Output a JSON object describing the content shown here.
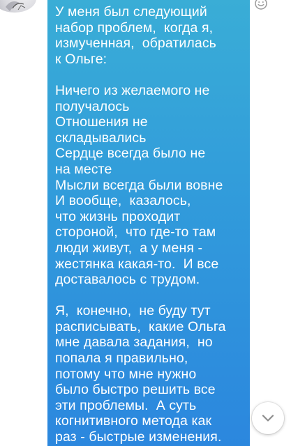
{
  "message": {
    "lines": [
      "У меня был следующий",
      "набор проблем,  когда я,",
      "измученная,  обратилась",
      "к Ольге:",
      "",
      "Ничего из желаемого не",
      "получалось",
      "Отношения не",
      "складывались",
      "Сердце всегда было не",
      "на месте",
      "Мысли всегда были вовне",
      "И вообще,  казалось,",
      "что жизнь проходит",
      "стороной,  что где-то там",
      "люди живут,  а у меня -",
      "жестянка какая-то.  И все",
      "доставалось с трудом.",
      "",
      "Я,  конечно,  не буду тут",
      "расписывать,  какие Ольга",
      "мне давала задания,  но",
      "попала я правильно,",
      "потому что мне нужно",
      "было быстро решить все",
      "эти проблемы.  А суть",
      "когнитивного метода как",
      "раз - быстрые изменения."
    ]
  },
  "colors": {
    "bubble_top": "#3aaed6",
    "bubble_bottom": "#2b86de",
    "text": "#ffffff",
    "icon": "#9a9a9a"
  },
  "icons": {
    "react": "smiley-icon",
    "scroll_down": "chevron-down-icon"
  }
}
